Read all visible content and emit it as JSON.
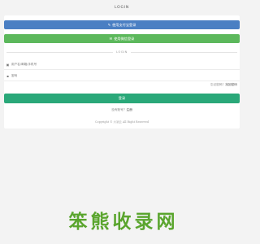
{
  "page": {
    "title": "LOGIN"
  },
  "oauth": {
    "alipay_label": "使用支付宝登录",
    "wechat_label": "使用微信登录"
  },
  "divider": {
    "label": "LOGIN"
  },
  "form": {
    "username_placeholder": "用户名/邮箱/手机号",
    "password_placeholder": "密码",
    "forgot_prefix": "忘记密码？",
    "forgot_link": "找回密码",
    "login_label": "登录"
  },
  "register": {
    "prefix": "没有账号？",
    "link": "注册"
  },
  "footer": {
    "copyright": "Copyright © 六派云 All Right Reserved"
  },
  "watermark": {
    "chars": [
      "笨",
      "熊",
      "收",
      "录"
    ],
    "latin": "网"
  },
  "colors": {
    "alipay": "#4a7fc3",
    "wechat": "#5cb85c",
    "login": "#2aa879",
    "watermark": "#5aa52e"
  },
  "icons": {
    "alipay": "alipay-icon",
    "wechat": "wechat-icon",
    "username": "user-icon",
    "password": "lock-icon"
  }
}
